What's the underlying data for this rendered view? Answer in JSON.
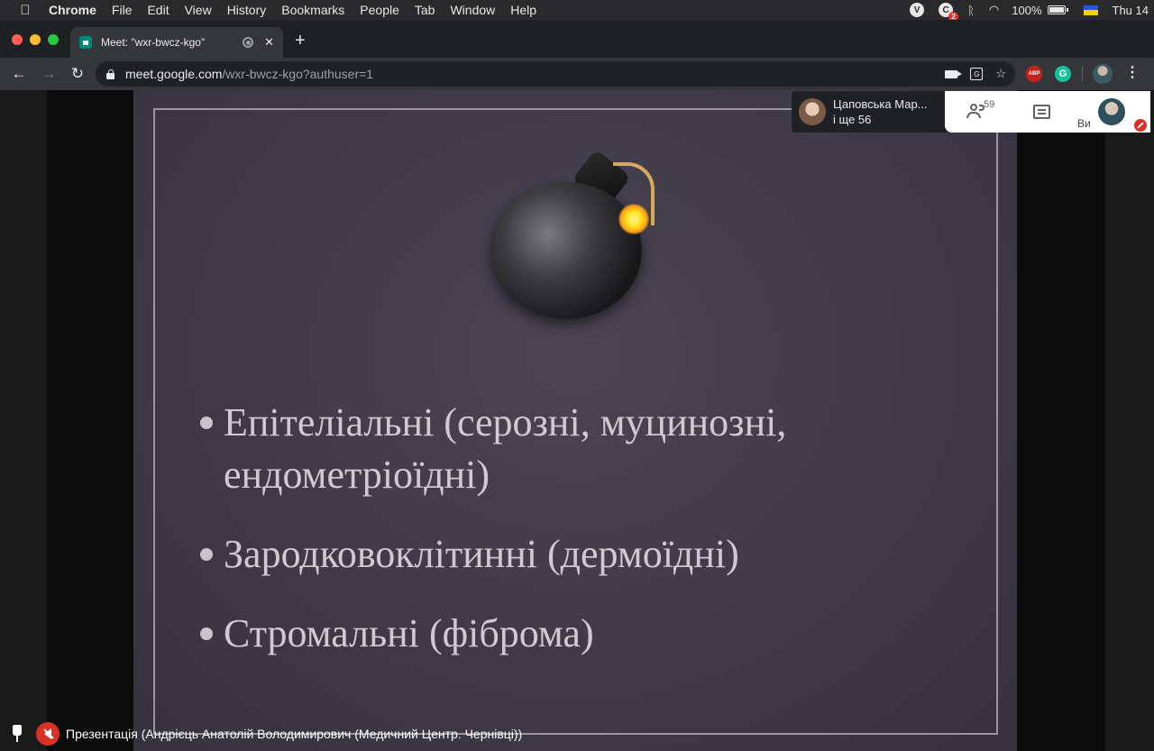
{
  "menubar": {
    "items": [
      "Chrome",
      "File",
      "Edit",
      "View",
      "History",
      "Bookmarks",
      "People",
      "Tab",
      "Window",
      "Help"
    ],
    "badge_count": "2",
    "battery": "100%",
    "clock": "Thu 14"
  },
  "tab": {
    "title": "Meet: \"wxr-bwcz-kgo\"",
    "close": "✕"
  },
  "toolbar": {
    "url_host": "meet.google.com",
    "url_path": "/wxr-bwcz-kgo?authuser=1",
    "ext_abp": "ABP",
    "ext_g": "G"
  },
  "meet": {
    "participant_name": "Цаповська Мар...",
    "participant_more": "і ще 56",
    "participants_count": "59",
    "self_label": "Ви",
    "presentation_caption": "Презентація (Андрієць Анатолій Володимирович (Медичний Центр. Чернівці))"
  },
  "slide": {
    "bullets": [
      "Епітеліальні (серозні, муцинозні, ендометріоїдні)",
      "Зародковоклітинні (дермоїдні)",
      "Стромальні (фіброма)"
    ]
  },
  "colors": {
    "slide_bg": "#3f3a48",
    "slide_text": "#cfcad2",
    "alert_red": "#d93025"
  }
}
